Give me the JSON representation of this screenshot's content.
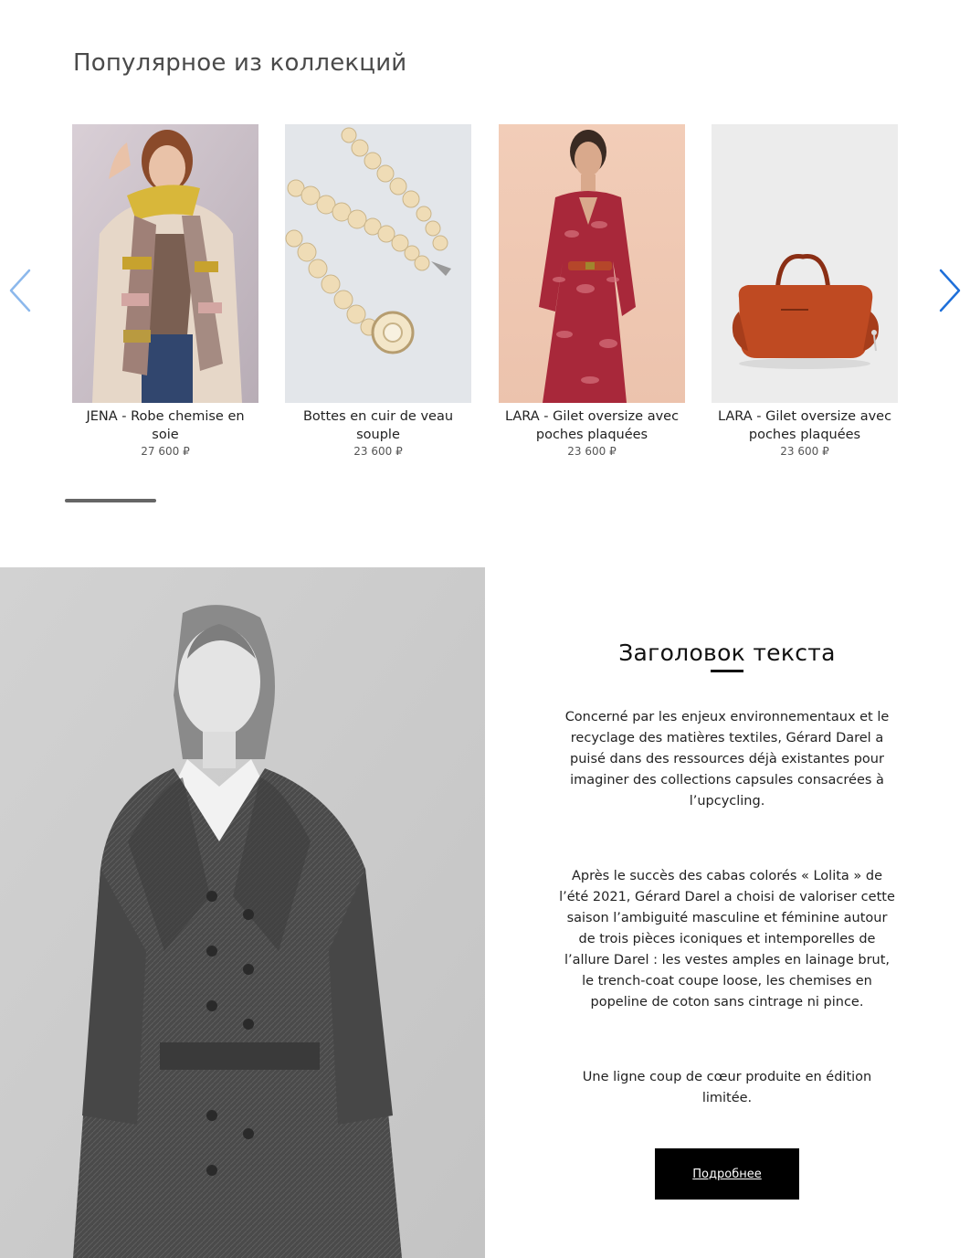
{
  "section": {
    "title": "Популярное из коллекций"
  },
  "carousel": {
    "prev_icon": "chevron-left-icon",
    "next_icon": "chevron-right-icon",
    "accent": "#1e6fd9",
    "products": [
      {
        "name": "JENA - Robe chemise en soie",
        "price": "27 600 ₽"
      },
      {
        "name": "Bottes en cuir de veau souple",
        "price": "23 600 ₽"
      },
      {
        "name": "LARA - Gilet oversize avec poches plaquées",
        "price": "23 600 ₽"
      },
      {
        "name": "LARA - Gilet oversize avec poches plaquées",
        "price": "23 600 ₽"
      }
    ]
  },
  "editorial": {
    "title": "Заголовок текста",
    "paragraphs": [
      "Concerné par les enjeux environnementaux et le recyclage des matières textiles, Gérard Darel a puisé dans des ressources déjà existantes pour imaginer des collections capsules consacrées à l’upcycling.",
      "Après le succès des cabas colorés « Lolita » de l’été 2021, Gérard Darel a choisi de valoriser cette saison l’ambiguité masculine et féminine autour de trois pièces iconiques et intemporelles de l’allure Darel : les vestes amples en lainage brut, le trench-coat coupe loose, les chemises en popeline de coton sans cintrage ni pince.",
      "Une ligne coup de cœur produite en édition limitée."
    ],
    "button_label": "Подробнее"
  }
}
